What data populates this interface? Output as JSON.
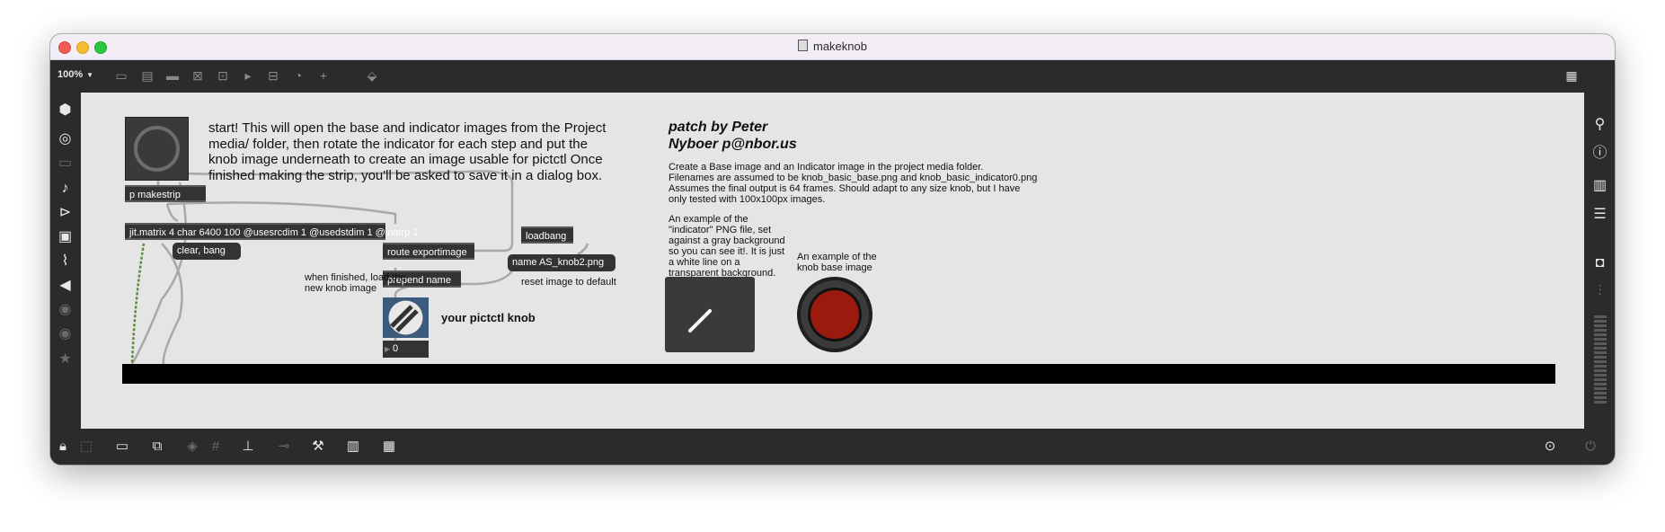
{
  "window": {
    "title": "makeknob"
  },
  "toolbar": {
    "zoom": "100%",
    "icons": [
      "presentation-icon",
      "inlet-icon",
      "comment-icon",
      "button-icon",
      "toggle-icon",
      "number-icon",
      "slider-icon",
      "dial-icon",
      "add-icon",
      "paint-bucket-icon"
    ]
  },
  "left_sidebar": [
    "packages-icon",
    "patcher-icon",
    "keyboard-icon",
    "audio-icon",
    "video-icon",
    "image-icon",
    "attach-icon",
    "plug-icon",
    "vimeo-icon",
    "help-icon",
    "star-icon"
  ],
  "right_sidebar": [
    "search-icon",
    "info-icon",
    "reference-icon",
    "list-icon",
    "snapshot-icon",
    "mixer-icon"
  ],
  "patch": {
    "intro": "start! This will open the base and indicator images from the Project\nmedia/ folder, then rotate the indicator for each step and put the\nknob image underneath to create an image usable for pictctl Once\nfinished making the strip, you'll be asked to save it in a dialog box.",
    "author": "patch by Peter\nNyboer p@nbor.us",
    "description": "Create a Base image and an Indicator image in the project media folder.\nFilenames are assumed to be knob_basic_base.png and knob_basic_indicator0.png\nAssumes the final output is 64 frames. Should adapt to any size knob, but I have\nonly tested with 100x100px images.",
    "objects": {
      "makestrip": "p makestrip",
      "jit_matrix": "jit.matrix 4 char 6400 100 @usesrcdim 1 @usedstdim 1 @interp 1",
      "route": "route exportimage",
      "prepend": "prepend name",
      "loadbang": "loadbang"
    },
    "messages": {
      "clear": "clear, bang",
      "name": "name AS_knob2.png"
    },
    "comments": {
      "when_finished": "when finished, load the\nnew knob image",
      "reset": "reset image to default",
      "indicator_example": "An example of the\n\"indicator\" PNG file, set\nagainst a gray background\nso you can see it!. It is just\na white line on a\ntransparent background.",
      "base_example": "An example of the\nknob base image",
      "your_knob": "your pictctl knob"
    },
    "number_value": "0",
    "colors": {
      "canvas": "#e5e5e5",
      "object": "#333333",
      "knob_base": "#9b1a0e",
      "patch_cord": "#a8a8a8",
      "signal_cord": "#5b8a3a"
    }
  }
}
